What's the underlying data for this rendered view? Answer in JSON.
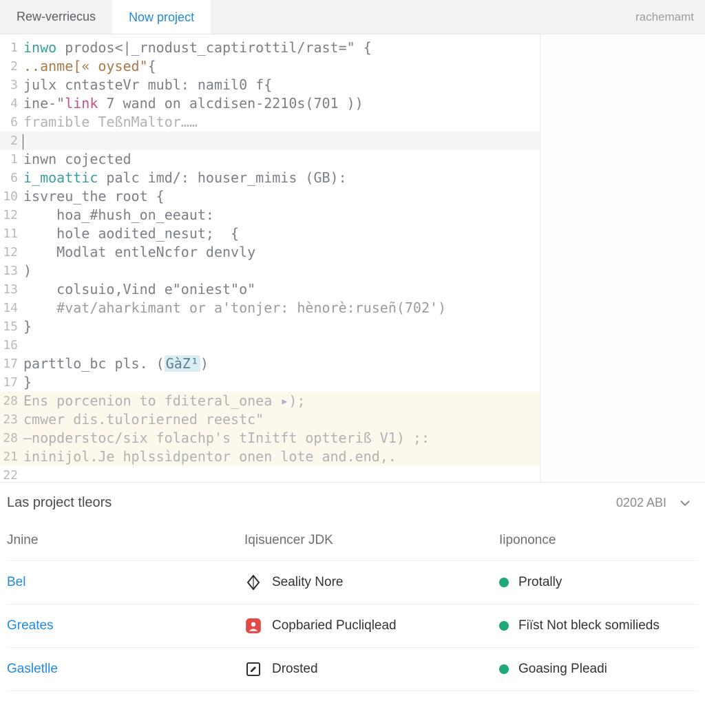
{
  "tabs": {
    "items": [
      {
        "label": "Rew-verriecus",
        "active": false
      },
      {
        "label": "Now project",
        "active": true
      }
    ],
    "user": "rachemamt"
  },
  "code": {
    "lines": [
      {
        "num": "1",
        "segments": [
          {
            "t": "inwo",
            "c": "teal"
          },
          {
            "t": " prodos<|_rnodust_captirottil/rast=\" {",
            "c": ""
          }
        ]
      },
      {
        "num": "2",
        "segments": [
          {
            "t": "..anme[« oysed\"",
            "c": "brown"
          },
          {
            "t": "{",
            "c": ""
          }
        ]
      },
      {
        "num": "3",
        "segments": [
          {
            "t": "julx cntasteVr mubl: namil0 f{",
            "c": ""
          }
        ]
      },
      {
        "num": "4",
        "segments": [
          {
            "t": "ine-\"",
            "c": ""
          },
          {
            "t": "link",
            "c": "magenta"
          },
          {
            "t": " 7 wand on alcdisen-2210s(701 ))",
            "c": ""
          }
        ]
      },
      {
        "num": "6",
        "segments": [
          {
            "t": "framible TeßnMaltor……",
            "c": "gray-lt"
          }
        ]
      },
      {
        "num": "2",
        "segments": [],
        "cursor": true
      },
      {
        "num": "1",
        "segments": [
          {
            "t": "inwn cojected",
            "c": ""
          }
        ]
      },
      {
        "num": "6",
        "segments": [
          {
            "t": "i_moattic",
            "c": "teal"
          },
          {
            "t": " palc imd/: houser_mimis (GB):",
            "c": ""
          }
        ]
      },
      {
        "num": "10",
        "segments": [
          {
            "t": "isvreu_the root {",
            "c": ""
          }
        ]
      },
      {
        "num": "12",
        "segments": [
          {
            "t": "    hoa_#hush_on_eeaut:",
            "c": ""
          }
        ]
      },
      {
        "num": "11",
        "segments": [
          {
            "t": "    hole aodited_nesut;  {",
            "c": ""
          }
        ]
      },
      {
        "num": "12",
        "segments": [
          {
            "t": "    Modlat entleNcfor denvly",
            "c": ""
          }
        ]
      },
      {
        "num": "13",
        "segments": [
          {
            "t": ")",
            "c": ""
          }
        ]
      },
      {
        "num": "13",
        "segments": [
          {
            "t": "    colsuio,Vind e\"oniest\"o\"",
            "c": ""
          }
        ]
      },
      {
        "num": "14",
        "segments": [
          {
            "t": "    ",
            "c": ""
          },
          {
            "t": "#vat/aharkimant or a'tonjer: hènorè:ruseñ(702')",
            "c": "comment"
          }
        ]
      },
      {
        "num": "15",
        "segments": [
          {
            "t": "}",
            "c": ""
          }
        ]
      },
      {
        "num": "16",
        "segments": []
      },
      {
        "num": "17",
        "segments": [
          {
            "t": "parttlo_bc pls. (",
            "c": ""
          },
          {
            "t": "GàZ¹",
            "c": "high"
          },
          {
            "t": ")",
            "c": ""
          }
        ]
      },
      {
        "num": "17",
        "segments": [
          {
            "t": "}",
            "c": ""
          }
        ]
      },
      {
        "num": "28",
        "segments": [
          {
            "t": "Ens porcenion to fditeral_onea ▸);",
            "c": "gray-lt"
          }
        ],
        "warn": true
      },
      {
        "num": "23",
        "segments": [
          {
            "t": "cmwer dis.tulorierned reestc\"",
            "c": "gray-lt"
          }
        ],
        "warn": true
      },
      {
        "num": "28",
        "segments": [
          {
            "t": "—nopderstoc/six folachp's tInitft optteriß V1) ;:",
            "c": "gray-lt"
          }
        ],
        "warn": true
      },
      {
        "num": "21",
        "segments": [
          {
            "t": "ininijol.Je hplssìdpentor onen lote and.end,.",
            "c": "gray-lt"
          }
        ],
        "warn": true
      },
      {
        "num": "22",
        "segments": []
      }
    ]
  },
  "panel": {
    "title": "Las project tleors",
    "meta": "0202 ABI",
    "columns": [
      "Jnine",
      "Iqisuencer JDK",
      "Iiрononce"
    ],
    "rows": [
      {
        "name": "Bel",
        "icon": "diamond",
        "jdk": "Seality Nore",
        "status_color": "#1fa97a",
        "status": "Protally"
      },
      {
        "name": "Greates",
        "icon": "badge-red",
        "jdk": "Copbaried Pucliqlead",
        "status_color": "#1fa97a",
        "status": "Fiïst Not bleck somilieds"
      },
      {
        "name": "Gasletlle",
        "icon": "edit-square",
        "jdk": "Drosted",
        "status_color": "#1fa97a",
        "status": "Goasing Pleadi"
      }
    ]
  }
}
